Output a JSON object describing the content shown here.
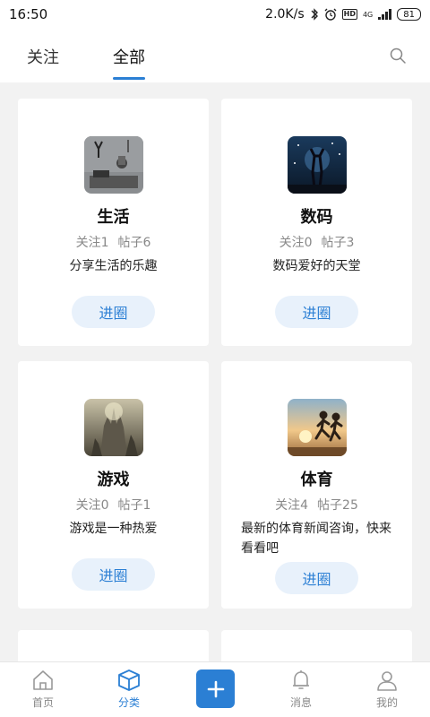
{
  "status_bar": {
    "time": "16:50",
    "network_speed": "2.0K/s",
    "network_type": "4G",
    "battery": "81"
  },
  "header": {
    "tabs": [
      {
        "label": "关注"
      },
      {
        "label": "全部"
      }
    ]
  },
  "cards": [
    {
      "title": "生活",
      "followers": "关注1",
      "posts": "帖子6",
      "desc": "分享生活的乐趣",
      "button": "进圈"
    },
    {
      "title": "数码",
      "followers": "关注0",
      "posts": "帖子3",
      "desc": "数码爱好的天堂",
      "button": "进圈"
    },
    {
      "title": "游戏",
      "followers": "关注0",
      "posts": "帖子1",
      "desc": "游戏是一种热爱",
      "button": "进圈"
    },
    {
      "title": "体育",
      "followers": "关注4",
      "posts": "帖子25",
      "desc": "最新的体育新闻咨询，快来看看吧",
      "button": "进圈"
    }
  ],
  "bottom_nav": {
    "items": [
      {
        "label": "首页"
      },
      {
        "label": "分类"
      },
      {
        "label": "消息"
      },
      {
        "label": "我的"
      }
    ]
  },
  "colors": {
    "accent": "#2b7fd4",
    "background": "#f2f2f2"
  }
}
